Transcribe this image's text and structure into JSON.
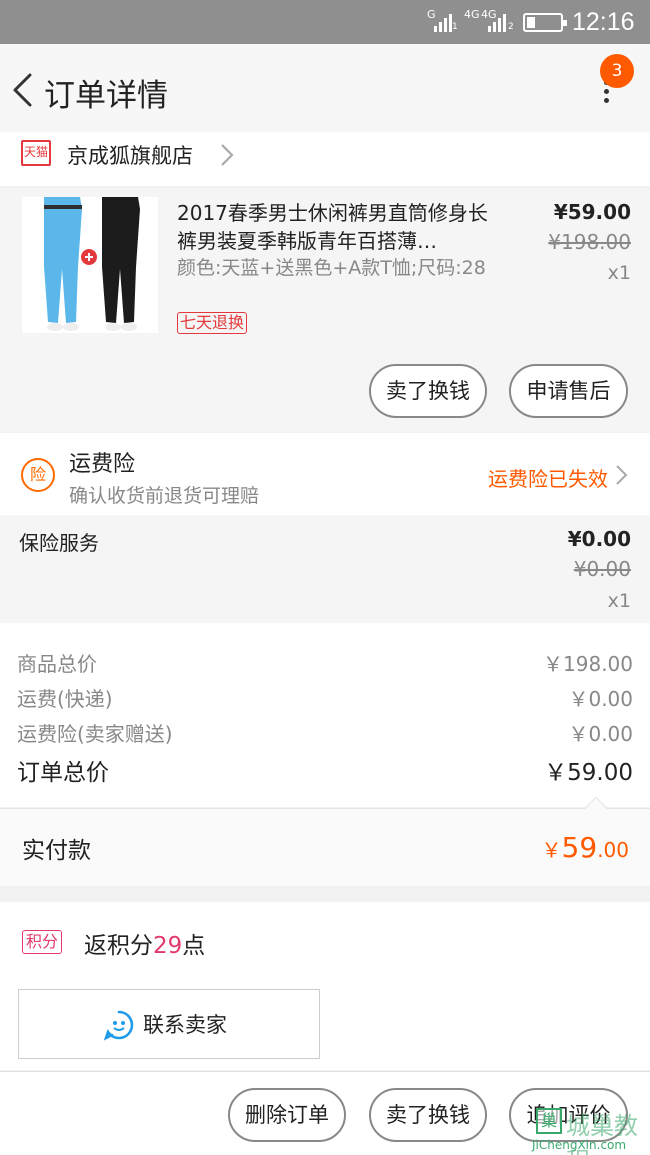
{
  "status_bar": {
    "sim1_label": "G",
    "sim1_sub": "1",
    "sim2_label": "4G",
    "sim2_label2": "4G",
    "sim2_sub": "2",
    "time": "12:16"
  },
  "header": {
    "title": "订单详情",
    "badge_count": "3"
  },
  "shop": {
    "platform_badge": "天猫",
    "name": "京成狐旗舰店"
  },
  "product": {
    "title": "2017春季男士休闲裤男直筒修身长裤男装夏季韩版青年百搭薄…",
    "spec": "颜色:天蓝+送黑色+A款T恤;尺码:28",
    "return_tag": "七天退换",
    "price": "¥59.00",
    "original_price": "¥198.00",
    "quantity": "x1",
    "sell_button": "卖了换钱",
    "after_sale_button": "申请售后"
  },
  "shipping_insurance": {
    "icon_label": "险",
    "title": "运费险",
    "description": "确认收货前退货可理赔",
    "status": "运费险已失效"
  },
  "insurance_service": {
    "label": "保险服务",
    "price": "¥0.00",
    "original_price": "¥0.00",
    "quantity": "x1"
  },
  "summary": {
    "rows": [
      {
        "label": "商品总价",
        "value": "￥198.00"
      },
      {
        "label": "运费(快递)",
        "value": "￥0.00"
      },
      {
        "label": "运费险(卖家赠送)",
        "value": "￥0.00"
      }
    ],
    "total_label": "订单总价",
    "total_value": "￥59.00"
  },
  "payment": {
    "label": "实付款",
    "currency": "￥",
    "amount_int": "59",
    "amount_dec": ".00"
  },
  "points": {
    "tag": "积分",
    "text_prefix": "返积分",
    "value": "29",
    "text_suffix": "点",
    "contact_button": "联系卖家"
  },
  "bottom_bar": {
    "delete_button": "删除订单",
    "sell_button": "卖了换钱",
    "review_button": "追加评价"
  },
  "watermark": {
    "mark": "巢",
    "text": "城巢教程",
    "url": "JiChengXin.com"
  },
  "colors": {
    "accent": "#ff5a00",
    "tmall_red": "#e4393c",
    "points_pink": "#e4396b",
    "status_bar": "#8f8f8f"
  }
}
